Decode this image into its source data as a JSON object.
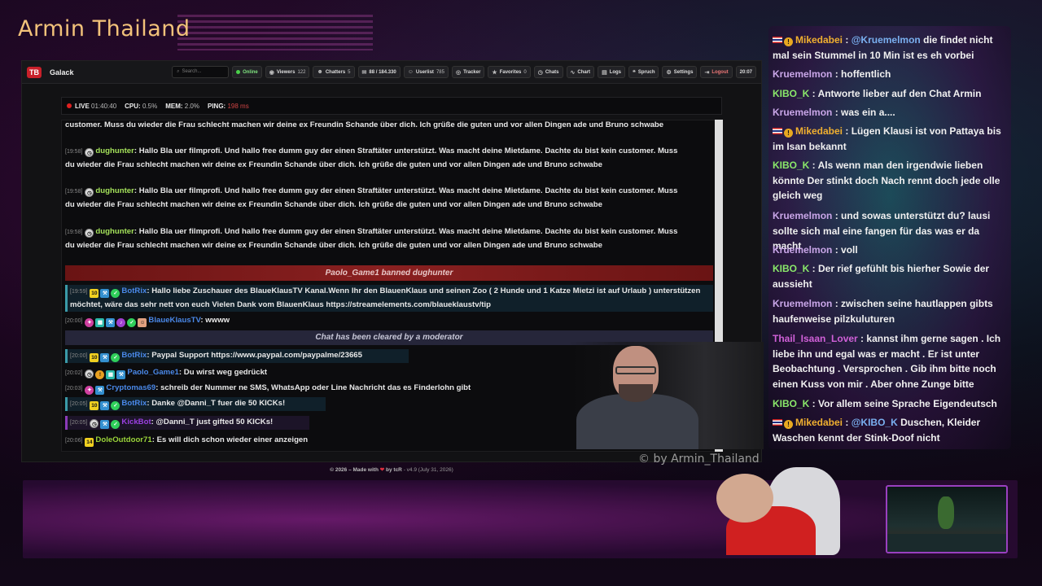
{
  "stream": {
    "title": "Armin Thailand",
    "watermark": "© by Armin_Thailand"
  },
  "topbar": {
    "logo": "TB",
    "brand": "Galack",
    "search_placeholder": "Search...",
    "items": [
      {
        "label": "Online",
        "value": ""
      },
      {
        "label": "Viewers",
        "value": "122"
      },
      {
        "label": "Chatters",
        "value": "5"
      },
      {
        "label": "88 / 184.330",
        "value": ""
      },
      {
        "label": "Userlist",
        "value": "785"
      },
      {
        "label": "Tracker",
        "value": ""
      },
      {
        "label": "Favorites",
        "value": "0"
      },
      {
        "label": "Chats",
        "value": ""
      },
      {
        "label": "Chart",
        "value": ""
      },
      {
        "label": "Logs",
        "value": ""
      },
      {
        "label": "Spruch",
        "value": ""
      },
      {
        "label": "Settings",
        "value": ""
      },
      {
        "label": "Logout",
        "value": ""
      }
    ],
    "clock": "20:07"
  },
  "status": {
    "live_label": "LIVE",
    "live_time": "01:40:40",
    "cpu_label": "CPU:",
    "cpu_value": "0.5%",
    "mem_label": "MEM:",
    "mem_value": "2.0%",
    "ping_label": "PING:",
    "ping_value": "198 ms"
  },
  "chat": {
    "partial_top": "customer. Muss du wieder die Frau schlecht machen wir deine ex Freundin Schande über dich. Ich grüße die guten und vor allen Dingen ade und Bruno schwabe",
    "repeated": [
      {
        "time": "[19:58]",
        "user": "dughunter",
        "text": "Hallo Bla uer filmprofi. Und hallo free dumm guy der einen Straftäter unterstützt. Was macht deine Mietdame. Dachte du bist kein customer. Muss du wieder die Frau schlecht machen wir deine ex Freundin Schande über dich. Ich grüße die guten und vor allen Dingen ade und Bruno schwabe"
      },
      {
        "time": "[19:58]",
        "user": "dughunter",
        "text": "Hallo Bla uer filmprofi. Und hallo free dumm guy der einen Straftäter unterstützt. Was macht deine Mietdame. Dachte du bist kein customer. Muss du wieder die Frau schlecht machen wir deine ex Freundin Schande über dich. Ich grüße die guten und vor allen Dingen ade und Bruno schwabe"
      },
      {
        "time": "[19:58]",
        "user": "dughunter",
        "text": "Hallo Bla uer filmprofi. Und hallo free dumm guy der einen Straftäter unterstützt. Was macht deine Mietdame. Dachte du bist kein customer. Muss du wieder die Frau schlecht machen wir deine ex Freundin Schande über dich. Ich grüße die guten und vor allen Dingen ade und Bruno schwabe"
      }
    ],
    "ban_notice": "Paolo_Game1 banned dughunter",
    "botrix1": {
      "time": "[19:59]",
      "badge": "10",
      "user": "BotRix",
      "text": "Hallo liebe Zuschauer des BlaueKlausTV Kanal.Wenn Ihr den BlauenKlaus und seinen Zoo ( 2 Hunde und 1 Katze Mietzi ist auf Urlaub ) unterstützen möchtet, wäre das sehr nett von euch Vielen Dank vom BlauenKlaus https://streamelements.com/blaueklaustv/tip"
    },
    "blaue": {
      "time": "[20:00]",
      "user": "BlaueKlausTV",
      "text": "wwww"
    },
    "clear_notice": "Chat has been cleared by a moderator",
    "botrix2": {
      "time": "[20:00]",
      "badge": "10",
      "user": "BotRix",
      "text": "Paypal Support https://www.paypal.com/paypalme/23665"
    },
    "paolo": {
      "time": "[20:02]",
      "user": "Paolo_Game1",
      "text": "Du wirst weg gedrückt"
    },
    "crypto": {
      "time": "[20:03]",
      "user": "Cryptomas69",
      "text": "schreib der Nummer ne SMS, WhatsApp oder Line Nachricht das es Finderlohn gibt"
    },
    "botrix3": {
      "time": "[20:05]",
      "badge": "10",
      "user": "BotRix",
      "text": "Danke @Danni_T fuer die 50 KICKs!"
    },
    "kickbot": {
      "time": "[20:05]",
      "user": "KickBot",
      "text": "@Danni_T just gifted 50 KICKs!"
    },
    "dole": {
      "time": "[20:06]",
      "badge": "14",
      "user": "DoleOutdoor71",
      "text": "Es will dich schon wieder einer anzeigen"
    }
  },
  "footer": {
    "prefix": "© 2026 – Made with",
    "suffix": "by tcR",
    "version": "- v4.9 (July 31, 2026)"
  },
  "overlay": [
    {
      "user": "Mikedabei",
      "mention": "@Kruemelmon",
      "text": "die findet nicht mal sein Stummel in 10 Min ist es eh vorbei"
    },
    {
      "user": "Kruemelmon",
      "mention": "",
      "text": "hoffentlich"
    },
    {
      "user": "KIBO_K",
      "mention": "",
      "text": "Antworte lieber auf den Chat Armin"
    },
    {
      "user": "Kruemelmon",
      "mention": "",
      "text": "was ein a...."
    },
    {
      "user": "Mikedabei",
      "mention": "",
      "text": "Lügen Klausi ist von Pattaya bis im Isan bekannt"
    },
    {
      "user": "KIBO_K",
      "mention": "",
      "text": "Als wenn man den irgendwie lieben könnte Der stinkt doch Nach rennt doch jede olle gleich weg"
    },
    {
      "user": "Kruemelmon",
      "mention": "",
      "text": "und sowas unterstützt du? lausi sollte sich mal eine fangen für das was er da macht"
    },
    {
      "user": "Kruemelmon",
      "mention": "",
      "text": "voll"
    },
    {
      "user": "KIBO_K",
      "mention": "",
      "text": "Der rief gefühlt bis hierher Sowie der aussieht"
    },
    {
      "user": "Kruemelmon",
      "mention": "",
      "text": "zwischen seine hautlappen gibts haufenweise pilzkuluturen"
    },
    {
      "user": "Thail_Isaan_Lover",
      "mention": "",
      "text": "kannst ihm gerne sagen . Ich liebe ihn und egal was er macht . Er ist unter Beobachtung . Versprochen . Gib ihm bitte noch einen Kuss von mir . Aber ohne Zunge bitte"
    },
    {
      "user": "KIBO_K",
      "mention": "",
      "text": "Vor allem seine Sprache Eigendeutsch"
    },
    {
      "user": "Mikedabei",
      "mention": "@KIBO_K",
      "text": "Duschen, Kleider Waschen kennt der Stink-Doof nicht"
    }
  ],
  "overlay_badge": "!"
}
